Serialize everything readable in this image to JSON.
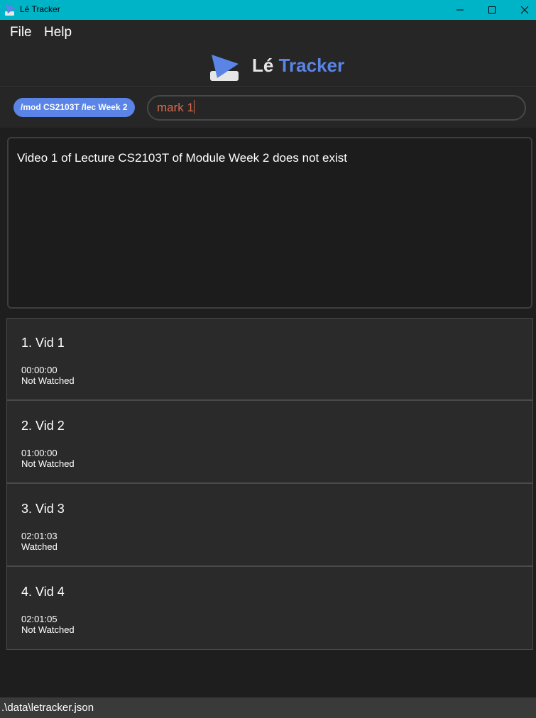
{
  "window": {
    "title": "Lé Tracker",
    "icons": {
      "app": "app-logo-icon",
      "minimize": "minimize-icon",
      "maximize": "maximize-icon",
      "close": "close-icon"
    }
  },
  "menu": {
    "file": "File",
    "help": "Help"
  },
  "brand": {
    "part1": "Lé",
    "part2": "Tracker",
    "accent_color": "#5a84e6"
  },
  "command": {
    "context": "/mod CS2103T /lec Week 2",
    "input_value": "mark 1",
    "input_color": "#d56a4e"
  },
  "result": {
    "message": "Video 1 of Lecture CS2103T of Module Week 2 does not exist"
  },
  "videos": [
    {
      "title": "1.  Vid 1",
      "timestamp": "00:00:00",
      "status": "Not Watched"
    },
    {
      "title": "2.  Vid 2",
      "timestamp": "01:00:00",
      "status": "Not Watched"
    },
    {
      "title": "3.  Vid 3",
      "timestamp": "02:01:03",
      "status": "Watched"
    },
    {
      "title": "4.  Vid 4",
      "timestamp": "02:01:05",
      "status": "Not Watched"
    }
  ],
  "status_bar": {
    "path": ".\\data\\letracker.json"
  }
}
